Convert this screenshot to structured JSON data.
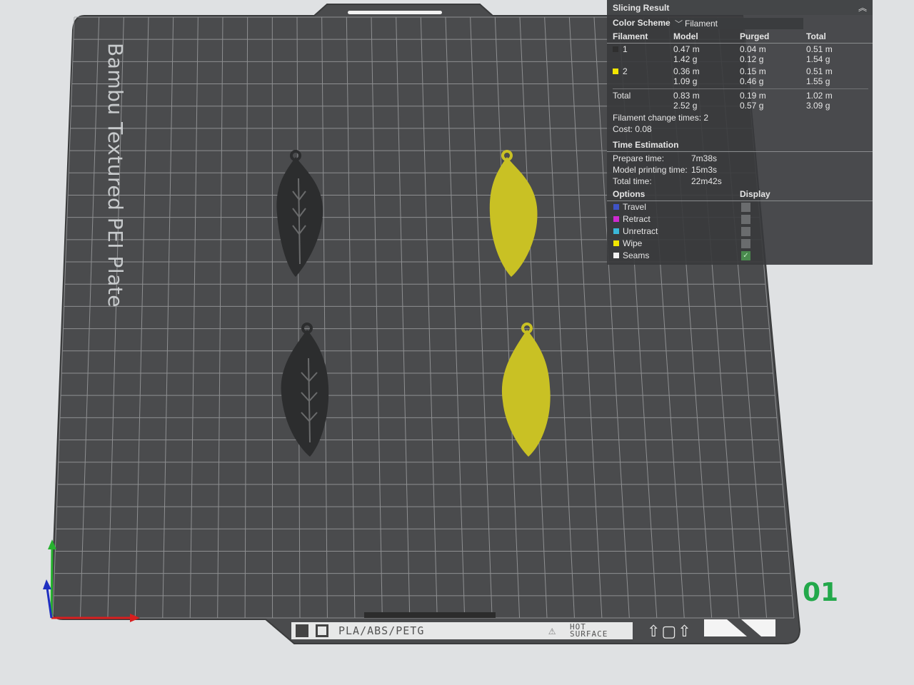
{
  "plate": {
    "name": "Bambu Textured PEI Plate",
    "number": "01",
    "material": "PLA/ABS/PETG",
    "warning": "HOT\nSURFACE"
  },
  "panel": {
    "title": "Slicing Result",
    "color_scheme_label": "Color Scheme",
    "color_scheme_value": "Filament",
    "headers": [
      "Filament",
      "Model",
      "Purged",
      "Total"
    ],
    "filaments": [
      {
        "id": "1",
        "color": "#2f2f2f",
        "model": [
          "0.47 m",
          "1.42 g"
        ],
        "purged": [
          "0.04 m",
          "0.12 g"
        ],
        "total": [
          "0.51 m",
          "1.54 g"
        ]
      },
      {
        "id": "2",
        "color": "#f2e600",
        "model": [
          "0.36 m",
          "1.09 g"
        ],
        "purged": [
          "0.15 m",
          "0.46 g"
        ],
        "total": [
          "0.51 m",
          "1.55 g"
        ]
      }
    ],
    "total_row": {
      "label": "Total",
      "model": [
        "0.83 m",
        "2.52 g"
      ],
      "purged": [
        "0.19 m",
        "0.57 g"
      ],
      "total": [
        "1.02 m",
        "3.09 g"
      ]
    },
    "filament_change": "Filament change times:  2",
    "cost": "Cost:  0.08",
    "time_title": "Time Estimation",
    "times": [
      {
        "label": "Prepare time:",
        "value": "7m38s"
      },
      {
        "label": "Model printing time:",
        "value": "15m3s"
      },
      {
        "label": "Total time:",
        "value": "22m42s"
      }
    ],
    "options_header": "Options",
    "display_header": "Display",
    "options": [
      {
        "label": "Travel",
        "color": "#3f53c6",
        "checked": false
      },
      {
        "label": "Retract",
        "color": "#cf2ad0",
        "checked": false
      },
      {
        "label": "Unretract",
        "color": "#3ab7d8",
        "checked": false
      },
      {
        "label": "Wipe",
        "color": "#f2e600",
        "checked": false
      },
      {
        "label": "Seams",
        "color": "#f2f2f2",
        "checked": true
      }
    ]
  },
  "colors": {
    "plate": "#4a4b4d",
    "grid": "#9a9c9e",
    "dark_feather": "#2c2d2e",
    "yellow_feather": "#c9c124",
    "axis_x": "#d81e1e",
    "axis_y": "#27b12f",
    "axis_z": "#1f2fc0"
  }
}
